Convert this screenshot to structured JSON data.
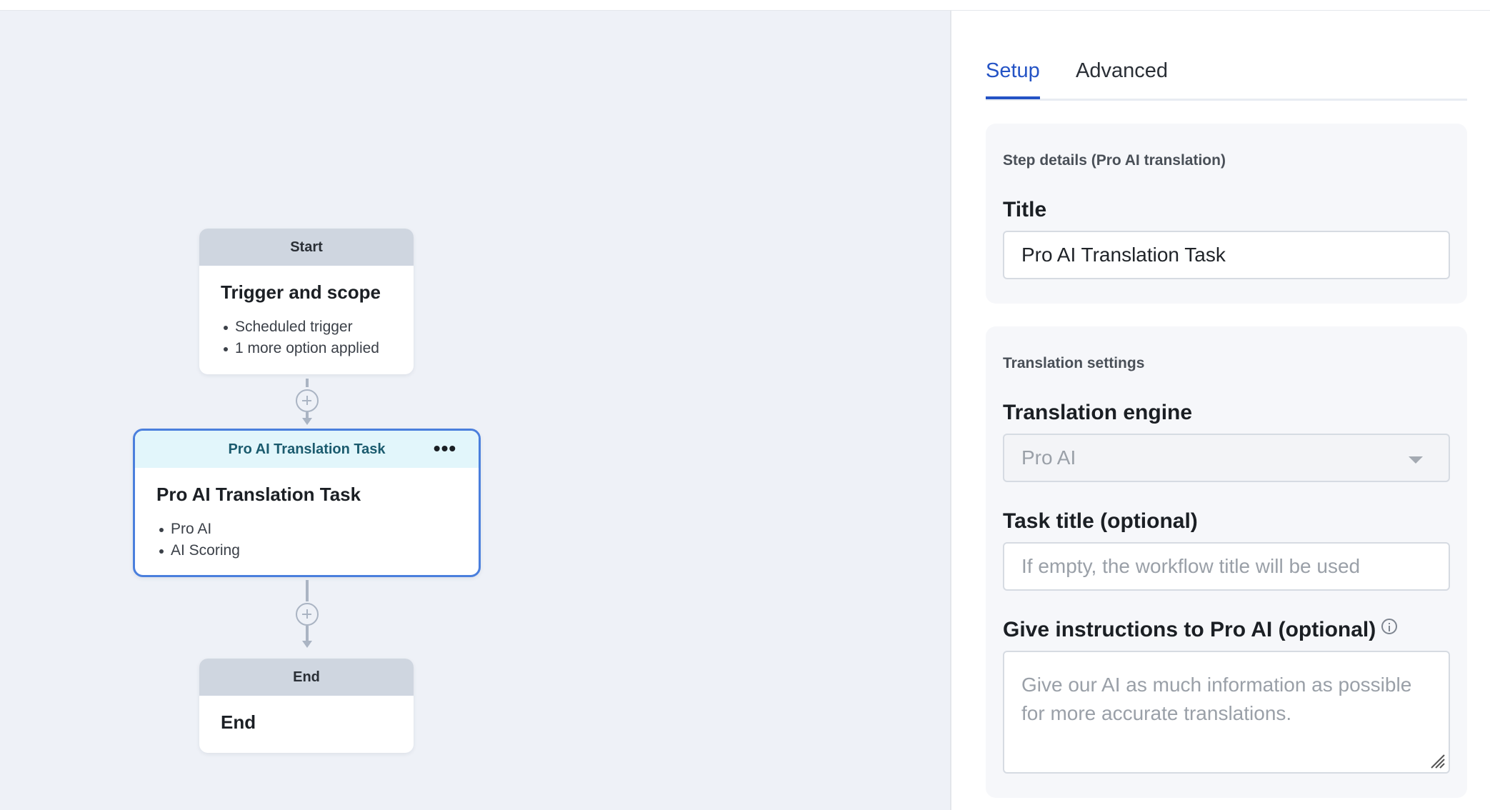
{
  "canvas": {
    "nodes": {
      "start": {
        "header": "Start",
        "title": "Trigger and scope",
        "items": [
          "Scheduled trigger",
          "1 more option applied"
        ]
      },
      "task": {
        "header": "Pro AI Translation Task",
        "more_label": "•••",
        "title": "Pro AI Translation Task",
        "items": [
          "Pro AI",
          "AI Scoring"
        ]
      },
      "end": {
        "header": "End",
        "title": "End"
      }
    }
  },
  "panel": {
    "tabs": [
      {
        "label": "Setup",
        "active": true
      },
      {
        "label": "Advanced",
        "active": false
      }
    ],
    "step_details": {
      "heading": "Step details (Pro AI translation)",
      "title_label": "Title",
      "title_value": "Pro AI Translation Task"
    },
    "translation_settings": {
      "heading": "Translation settings",
      "engine_label": "Translation engine",
      "engine_value": "Pro AI",
      "task_title_label": "Task title (optional)",
      "task_title_placeholder": "If empty, the workflow title will be used",
      "instructions_label": "Give instructions to Pro AI (optional)",
      "instructions_placeholder": "Give our AI as much information as possible for more accurate translations."
    }
  },
  "colors": {
    "accent": "#2453c5",
    "selected_border": "#4a7fdd",
    "canvas_bg": "#eef1f7"
  }
}
